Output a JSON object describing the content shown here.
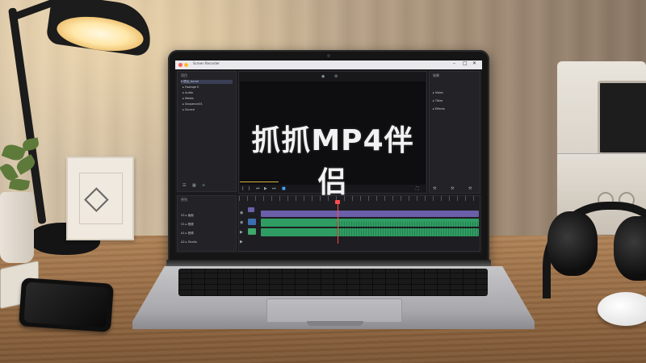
{
  "scene": {
    "description_objects": [
      "desk-lamp",
      "potted-plant",
      "picture-frame",
      "laptop",
      "smartphone",
      "headphones",
      "audio-device",
      "mouse"
    ]
  },
  "window": {
    "title": "Screen Recorder"
  },
  "left_panel": {
    "title": "项目",
    "items": [
      {
        "label": "项目_Aurial",
        "icon": "folder-icon"
      },
      {
        "label": "Footage E",
        "icon": "film-icon"
      },
      {
        "label": "Audio",
        "icon": "audio-icon"
      },
      {
        "label": "Media",
        "icon": "media-icon"
      },
      {
        "label": "Sequence01",
        "icon": "sequence-icon"
      },
      {
        "label": "Source",
        "icon": "source-icon"
      }
    ]
  },
  "right_panel": {
    "title": "效果",
    "items": [
      {
        "label": "Video",
        "icon": "folder-icon"
      },
      {
        "label": "Titles",
        "icon": "folder-icon"
      },
      {
        "label": "Effects",
        "icon": "folder-icon"
      }
    ]
  },
  "viewer": {
    "overlay_text": "抓抓MP4伴侣"
  },
  "timeline": {
    "header_label": "序列",
    "tracks": [
      {
        "label": "V2",
        "name": "画面",
        "color": "#6a5fa8"
      },
      {
        "label": "V1",
        "name": "视频",
        "color": "#3b6fb0"
      },
      {
        "label": "A1",
        "name": "音频",
        "color": "#3fa86b"
      },
      {
        "label": "A2",
        "name": "Studio",
        "color": "#3fa86b"
      }
    ]
  },
  "colors": {
    "video_clip": "#6a5fa8",
    "audio_clip": "#2f9d63",
    "playhead": "#ff4d4d",
    "lamp_glow": "#ffe7a8"
  }
}
